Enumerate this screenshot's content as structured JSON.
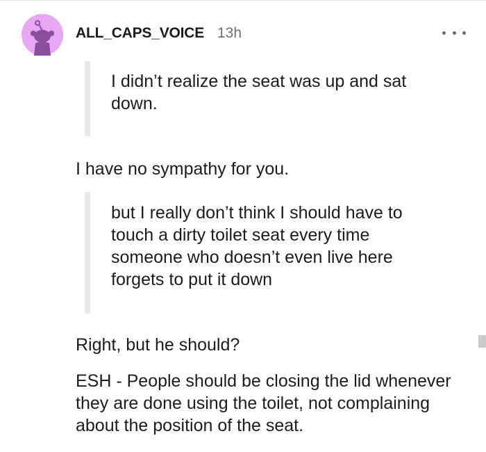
{
  "comment": {
    "username": "ALL_CAPS_VOICE",
    "timestamp": "13h",
    "avatar_icon": "reddit-snoo-avatar-icon",
    "more_icon": "more-options-icon",
    "colors": {
      "avatar_bg": "#e8a7f2",
      "avatar_snoo": "#8a4f9c",
      "quote_bar": "#e9e9e9",
      "meta_text": "#6f6f6f"
    },
    "quote_1": "I didn’t realize the seat was up and sat down.",
    "reply_1": "I have no sympathy for you.",
    "quote_2": "but I really don’t think I should have to touch a dirty toilet seat every time someone who doesn’t even live here forgets to put it down",
    "reply_2": "Right, but he should?",
    "verdict": "ESH - People should be closing the lid whenever they are done using the toilet, not complaining about the position of the seat."
  }
}
